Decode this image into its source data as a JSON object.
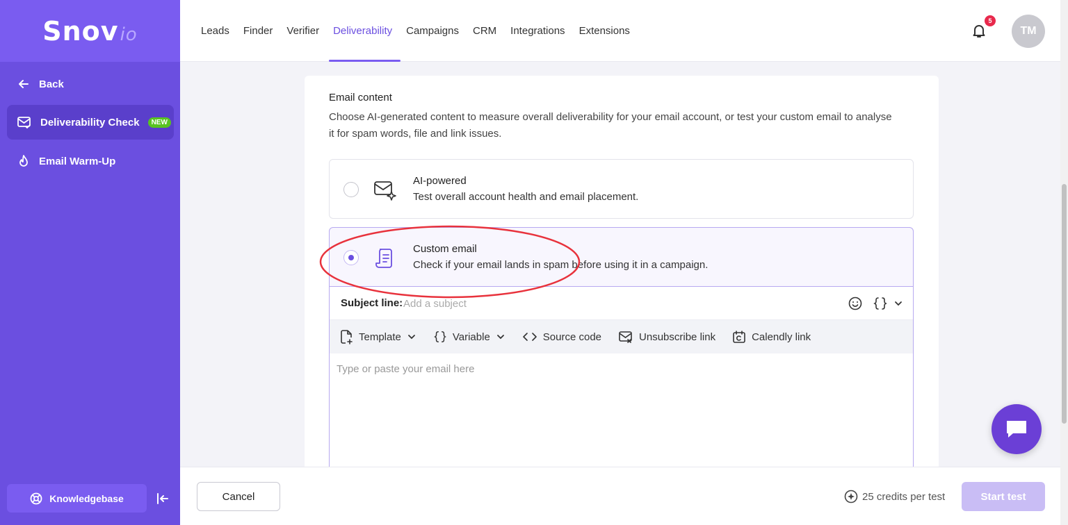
{
  "brand": {
    "name": "Snov",
    "suffix": "io"
  },
  "sidebar": {
    "back_label": "Back",
    "items": [
      {
        "label": "Deliverability Check",
        "badge": "NEW",
        "active": true
      },
      {
        "label": "Email Warm-Up",
        "active": false
      }
    ],
    "knowledgebase_label": "Knowledgebase"
  },
  "topnav": {
    "items": [
      "Leads",
      "Finder",
      "Verifier",
      "Deliverability",
      "Campaigns",
      "CRM",
      "Integrations",
      "Extensions"
    ],
    "active": "Deliverability",
    "notification_count": "5",
    "avatar_initials": "TM"
  },
  "content": {
    "title": "Email content",
    "description": "Choose AI-generated content to measure overall deliverability for your email account, or test your custom email to analyse it for spam words, file and link issues.",
    "options": [
      {
        "title": "AI-powered",
        "subtitle": "Test overall account health and email placement.",
        "selected": false,
        "icon": "mail-sparkle-icon"
      },
      {
        "title": "Custom email",
        "subtitle": "Check if your email lands in spam before using it in a campaign.",
        "selected": true,
        "icon": "document-icon"
      }
    ],
    "editor": {
      "subject_label": "Subject line:",
      "subject_placeholder": "Add a subject",
      "toolbar": {
        "template": "Template",
        "variable": "Variable",
        "source_code": "Source code",
        "unsubscribe": "Unsubscribe link",
        "calendly": "Calendly link"
      },
      "body_placeholder": "Type or paste your email here"
    }
  },
  "footer": {
    "cancel_label": "Cancel",
    "credits_label": "25 credits per test",
    "start_label": "Start test"
  },
  "colors": {
    "accent": "#6b4fe0",
    "sidebar": "#6b4fe0",
    "badge": "#58c322",
    "annotation": "#e8323c"
  }
}
